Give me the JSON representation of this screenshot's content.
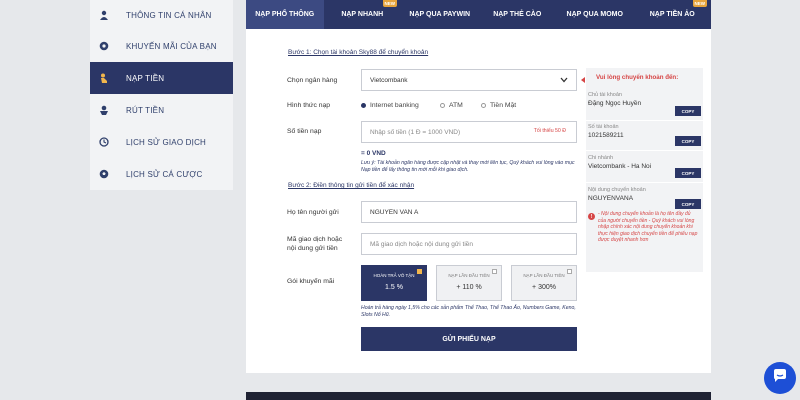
{
  "sidebar": {
    "items": [
      {
        "label": "THÔNG TIN CÁ NHÂN",
        "icon": "user-icon"
      },
      {
        "label": "KHUYẾN MÃI CỦA BẠN",
        "icon": "gift-icon"
      },
      {
        "label": "NẠP TIỀN",
        "icon": "hand-coin-icon",
        "active": true
      },
      {
        "label": "RÚT TIỀN",
        "icon": "withdraw-icon"
      },
      {
        "label": "LỊCH SỬ GIAO DỊCH",
        "icon": "history-icon"
      },
      {
        "label": "LỊCH SỬ CÁ CƯỢC",
        "icon": "soccer-ball-icon"
      }
    ]
  },
  "tabs": [
    {
      "label": "NẠP PHỔ THÔNG",
      "active": true
    },
    {
      "label": "NẠP NHANH",
      "badge": "NEW"
    },
    {
      "label": "NẠP QUA PAYWIN"
    },
    {
      "label": "NẠP THẺ CÀO"
    },
    {
      "label": "NẠP QUA MOMO"
    },
    {
      "label": "NẠP TIỀN ẢO",
      "badge": "NEW"
    }
  ],
  "form": {
    "step1": "Bước 1: Chọn tài khoản Sky88 để chuyển khoản",
    "bank_label": "Chọn ngân hàng",
    "bank_value": "Vietcombank",
    "method_label": "Hình thức nạp",
    "methods": [
      "Internet banking",
      "ATM",
      "Tiền Mặt"
    ],
    "amount_label": "Số tiền nạp",
    "amount_placeholder": "Nhập số tiền (1 Đ = 1000 VND)",
    "amount_limit": "Tối thiểu 50 Đ",
    "amount_converted": "= 0 VND",
    "note": "Lưu ý: Tài khoản ngân hàng được cập nhật và thay mới liên tục, Quý khách vui lòng vào mục Nạp tiền để lấy thông tin mới mỗi khi giao dịch.",
    "step2": "Bước 2: Điền thông tin gửi tiền để xác nhận",
    "sender_label": "Họ tên người gửi",
    "sender_value": "NGUYEN VAN A",
    "txn_label_1": "Mã giao dịch hoặc",
    "txn_label_2": "nội dung gửi tiền",
    "txn_placeholder": "Mã giao dịch hoặc nội dung gửi tiền",
    "promo_label": "Gói khuyến mãi",
    "promos": [
      {
        "title": "HOÀN TRẢ VÔ TẬN",
        "value": "1.5 %",
        "active": true
      },
      {
        "title": "NẠP LẦN ĐẦU TIÊN",
        "value": "+ 110 %"
      },
      {
        "title": "NẠP LẦN ĐẦU TIÊN",
        "value": "+ 300%"
      }
    ],
    "promo_note": "Hoàn trả hàng ngày 1,5% cho các sản phẩm Thể Thao, Thể Thao Ảo, Numbers Game, Keno, Slots Nổ Hũ.",
    "submit_label": "GỬI PHIẾU NẠP"
  },
  "info": {
    "heading": "Vui lòng chuyển khoản đến:",
    "copy_label": "COPY",
    "rows": [
      {
        "key": "Chủ tài khoản",
        "value": "Đặng Ngọc Huyền"
      },
      {
        "key": "Số tài khoản",
        "value": "1021589211"
      },
      {
        "key": "Chi nhánh",
        "value": "Vietcombank - Ha Noi"
      },
      {
        "key": "Nội dung chuyển khoản",
        "value": "NGUYENVANA"
      }
    ],
    "warning": "- Nội dung chuyển khoản là họ tên đầy đủ của người chuyển tiền - Quý khách vui lòng nhập chính xác nội dung chuyển khoản khi thực hiện giao dịch chuyển tiền để phiếu nạp được duyệt nhanh hơn"
  },
  "colors": {
    "navy": "#2b3666",
    "accent_red": "#d64545",
    "promo_gold": "#f2b64c",
    "chat_blue": "#1d4fd6"
  }
}
